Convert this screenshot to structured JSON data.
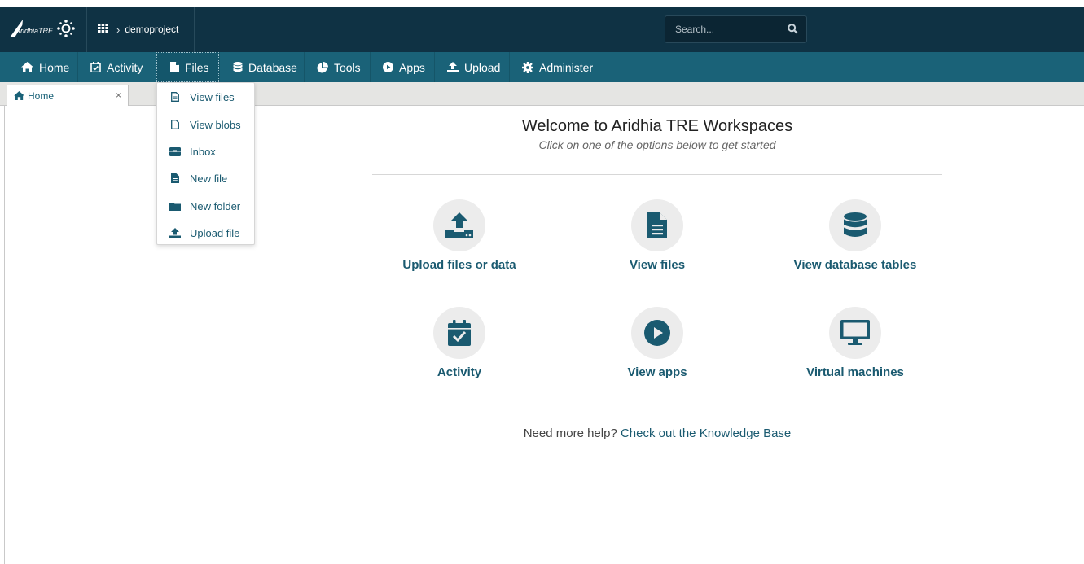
{
  "brand": {
    "logo_text": "aridhiaTRE"
  },
  "breadcrumb": {
    "project": "demoproject"
  },
  "search": {
    "placeholder": "Search..."
  },
  "nav": {
    "items": [
      {
        "label": "Home",
        "icon": "home-icon"
      },
      {
        "label": "Activity",
        "icon": "calendar-check-icon"
      },
      {
        "label": "Files",
        "icon": "file-icon",
        "active": true
      },
      {
        "label": "Database",
        "icon": "database-icon"
      },
      {
        "label": "Tools",
        "icon": "pie-chart-icon"
      },
      {
        "label": "Apps",
        "icon": "play-circle-icon"
      },
      {
        "label": "Upload",
        "icon": "upload-icon"
      },
      {
        "label": "Administer",
        "icon": "gear-icon"
      }
    ]
  },
  "tabs": [
    {
      "label": "Home",
      "close": "×"
    }
  ],
  "files_menu": {
    "items": [
      {
        "label": "View files",
        "icon": "file-text-icon"
      },
      {
        "label": "View blobs",
        "icon": "file-outline-icon"
      },
      {
        "label": "Inbox",
        "icon": "inbox-icon"
      },
      {
        "label": "New file",
        "icon": "file-new-icon"
      },
      {
        "label": "New folder",
        "icon": "folder-icon"
      },
      {
        "label": "Upload file",
        "icon": "upload-icon"
      }
    ]
  },
  "main": {
    "title": "Welcome to Aridhia TRE Workspaces",
    "subtitle": "Click on one of the options below to get started",
    "tiles": [
      {
        "label": "Upload files or data",
        "icon": "upload-tray-icon"
      },
      {
        "label": "View files",
        "icon": "file-text-icon"
      },
      {
        "label": "View database tables",
        "icon": "database-icon"
      },
      {
        "label": "Activity",
        "icon": "calendar-check-icon"
      },
      {
        "label": "View apps",
        "icon": "play-circle-icon"
      },
      {
        "label": "Virtual machines",
        "icon": "monitor-icon"
      }
    ],
    "help_prefix": "Need more help?",
    "help_link": "Check out the Knowledge Base"
  },
  "colors": {
    "topbar": "#0f3244",
    "navbar": "#1a6278",
    "accent": "#1a5a70",
    "icon_circle": "#ececec"
  }
}
